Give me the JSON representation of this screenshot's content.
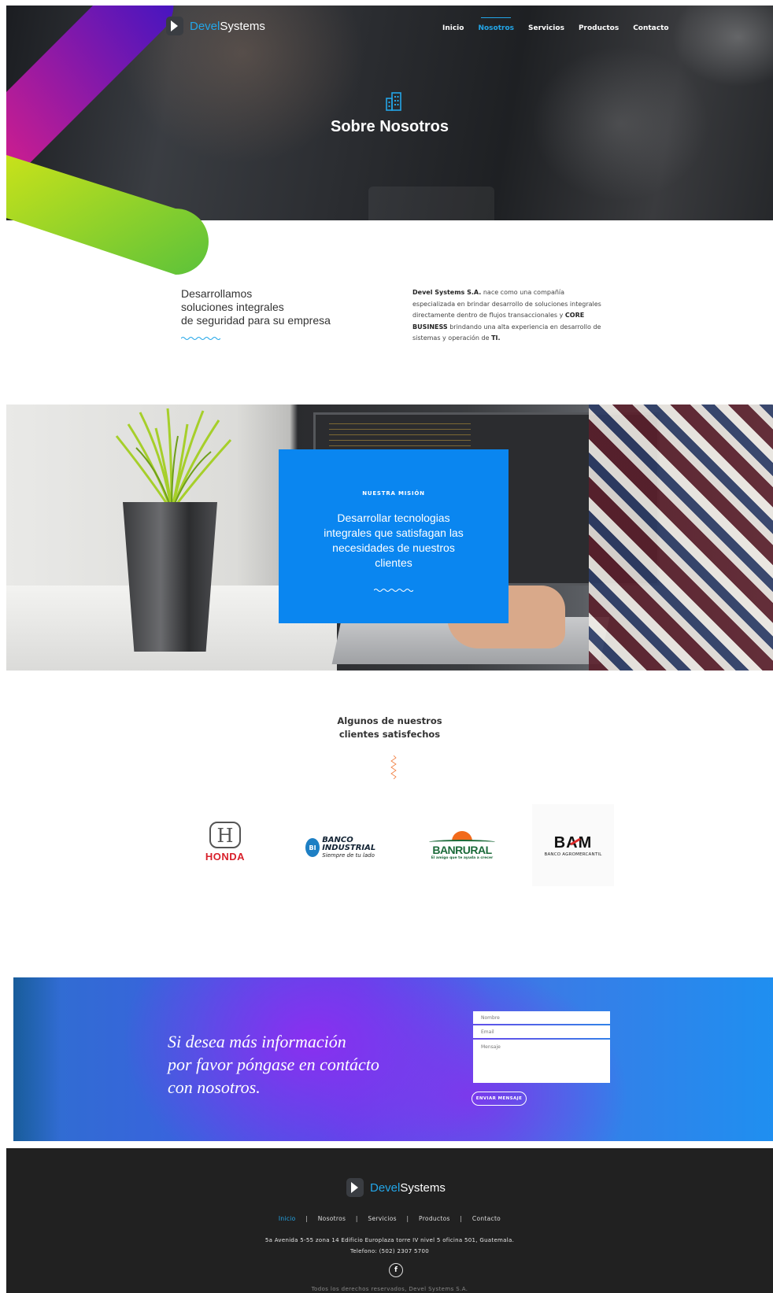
{
  "brand": {
    "part1": "Devel",
    "part2": "Systems",
    "accent_color": "#23a6e8"
  },
  "nav": {
    "items": [
      {
        "label": "Inicio"
      },
      {
        "label": "Nosotros"
      },
      {
        "label": "Servicios"
      },
      {
        "label": "Productos"
      },
      {
        "label": "Contacto"
      }
    ],
    "active": "Nosotros"
  },
  "hero": {
    "icon": "building-icon",
    "title": "Sobre Nosotros"
  },
  "intro": {
    "heading_lines": [
      "Desarrollamos",
      "soluciones integrales",
      "de seguridad para su empresa"
    ],
    "body": {
      "company": "Devel Systems S.A.",
      "text1": " nace como una compañía especializada en brindar desarrollo de soluciones integrales directamente dentro de flujos transaccionales y ",
      "core": "CORE BUSINESS",
      "text2": " brindando una alta experiencia en desarrollo de sistemas y operación de ",
      "ti": "TI."
    }
  },
  "mission": {
    "kicker": "NUESTRA MISIÓN",
    "statement": "Desarrollar tecnologias integrales que satisfagan las necesidades de nuestros clientes",
    "card_color": "#0a86f0"
  },
  "clients": {
    "title_lines": [
      "Algunos de nuestros",
      "clientes satisfechos"
    ],
    "logos": {
      "honda": "HONDA",
      "bi_badge": "BI",
      "bi_name": "Banco Industrial",
      "bi_tagline": "Siempre de tu lado",
      "banrural": "BANRURAL",
      "banrural_tagline": "El amigo que te ayuda a crecer",
      "bam": "BAM",
      "bam_sub": "BANCO AGROMERCANTIL"
    }
  },
  "contact": {
    "message_lines": [
      "Si desea más información",
      "por favor póngase en contácto",
      "con nosotros."
    ],
    "name_placeholder": "Nombre",
    "email_placeholder": "Email",
    "message_placeholder": "Mensaje",
    "send_label": "ENVIAR MENSAJE"
  },
  "footer": {
    "links": [
      "Inicio",
      "Nosotros",
      "Servicios",
      "Productos",
      "Contacto"
    ],
    "separator": "|",
    "address": "5a Avenida 5-55 zona 14 Edificio Europlaza torre IV nivel 5 oficina 501, Guatemala.",
    "phone": "Telefono: (502) 2307  5700",
    "social_icon": "facebook-icon",
    "facebook_glyph": "f",
    "copyright": "Todos los derechos reservados, Devel Systems S.A."
  }
}
